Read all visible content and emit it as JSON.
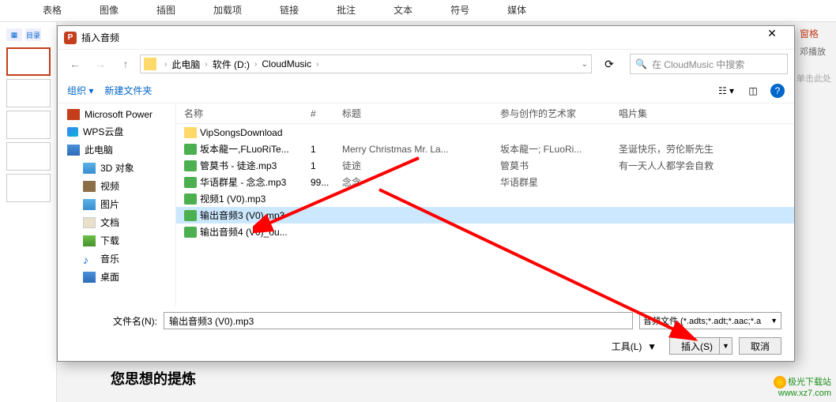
{
  "ribbon": [
    "表格",
    "图像",
    "插图",
    "加载项",
    "链接",
    "批注",
    "文本",
    "符号",
    "媒体"
  ],
  "slideOutline": [
    "缩",
    "目录"
  ],
  "bgRight": {
    "pane": "窗格",
    "play": "邓播放",
    "click": "单击此处"
  },
  "dialog": {
    "title": "插入音频",
    "breadcrumb": [
      "此电脑",
      "软件 (D:)",
      "CloudMusic"
    ],
    "searchPlaceholder": "在 CloudMusic 中搜索",
    "toolbar": {
      "organize": "组织",
      "newFolder": "新建文件夹"
    },
    "tree": [
      {
        "icon": "ic-ppt",
        "label": "Microsoft Power",
        "indent": false
      },
      {
        "icon": "ic-wps",
        "label": "WPS云盘",
        "indent": false
      },
      {
        "icon": "ic-pc",
        "label": "此电脑",
        "indent": false
      },
      {
        "icon": "ic-3d",
        "label": "3D 对象",
        "indent": true
      },
      {
        "icon": "ic-video",
        "label": "视频",
        "indent": true
      },
      {
        "icon": "ic-pic",
        "label": "图片",
        "indent": true
      },
      {
        "icon": "ic-doc",
        "label": "文档",
        "indent": true
      },
      {
        "icon": "ic-down",
        "label": "下载",
        "indent": true
      },
      {
        "icon": "ic-music",
        "label": "音乐",
        "indent": true,
        "glyph": "♪"
      },
      {
        "icon": "ic-pc",
        "label": "桌面",
        "indent": true
      }
    ],
    "columns": {
      "name": "名称",
      "num": "#",
      "title": "标题",
      "artist": "参与创作的艺术家",
      "album": "唱片集"
    },
    "files": [
      {
        "type": "folder",
        "name": "VipSongsDownload",
        "num": "",
        "title": "",
        "artist": "",
        "album": ""
      },
      {
        "type": "media",
        "name": "坂本龍一,FLuoRiTe...",
        "num": "1",
        "title": "Merry Christmas Mr. La...",
        "artist": "坂本龍一; FLuoRi...",
        "album": "圣诞快乐，劳伦斯先生"
      },
      {
        "type": "media",
        "name": "管莫书 - 徒途.mp3",
        "num": "1",
        "title": "徒途",
        "artist": "管莫书",
        "album": "有一天人人都学会自救"
      },
      {
        "type": "media",
        "name": "华语群星 - 念念.mp3",
        "num": "99...",
        "title": "念念",
        "artist": "华语群星",
        "album": ""
      },
      {
        "type": "media",
        "name": "视频1 (V0).mp3",
        "num": "",
        "title": "",
        "artist": "",
        "album": ""
      },
      {
        "type": "media",
        "name": "输出音频3 (V0).mp3",
        "num": "",
        "title": "",
        "artist": "",
        "album": "",
        "selected": true
      },
      {
        "type": "media",
        "name": "输出音频4 (V0)_ou...",
        "num": "",
        "title": "",
        "artist": "",
        "album": ""
      }
    ],
    "filenameLabel": "文件名(N):",
    "filenameValue": "输出音频3 (V0).mp3",
    "filetype": "音频文件 (*.adts;*.adt;*.aac;*.a",
    "toolsLabel": "工具(L)",
    "insertLabel": "插入(S)",
    "cancelLabel": "取消"
  },
  "bottomText": "您思想的提炼",
  "watermark": {
    "name": "极光下载站",
    "url": "www.xz7.com"
  }
}
